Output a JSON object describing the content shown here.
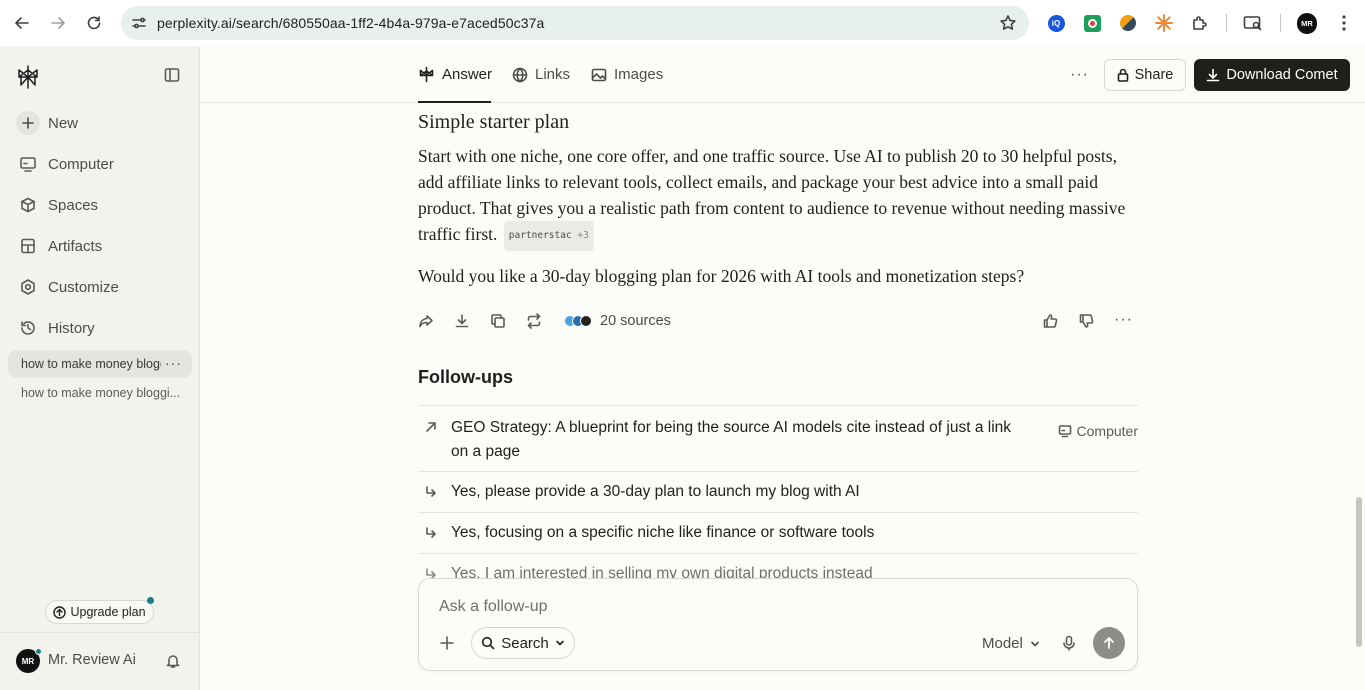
{
  "browser": {
    "url": "perplexity.ai/search/680550aa-1ff2-4b4a-979a-e7aced50c37a",
    "profile_initials": "MR"
  },
  "sidebar": {
    "items": [
      {
        "label": "New",
        "icon": "plus-icon"
      },
      {
        "label": "Computer",
        "icon": "computer-icon"
      },
      {
        "label": "Spaces",
        "icon": "spaces-icon"
      },
      {
        "label": "Artifacts",
        "icon": "artifacts-icon"
      },
      {
        "label": "Customize",
        "icon": "customize-icon"
      },
      {
        "label": "History",
        "icon": "history-icon"
      }
    ],
    "threads": [
      {
        "title": "how to make money blogging"
      },
      {
        "title": "how to make money bloggi..."
      }
    ],
    "upgrade_label": "Upgrade plan",
    "user": {
      "name": "Mr. Review Ai",
      "initials": "MR"
    }
  },
  "topbar": {
    "tabs": [
      {
        "label": "Answer",
        "active": true
      },
      {
        "label": "Links",
        "active": false
      },
      {
        "label": "Images",
        "active": false
      }
    ],
    "share_label": "Share",
    "download_label": "Download Comet"
  },
  "answer": {
    "heading": "Simple starter plan",
    "paragraph": "Start with one niche, one core offer, and one traffic source. Use AI to publish 20 to 30 helpful posts, add affiliate links to relevant tools, collect emails, and package your best advice into a small paid product. That gives you a realistic path from content to audience to revenue without needing massive traffic first.",
    "citation": {
      "label": "partnerstac",
      "more": "+3"
    },
    "question": "Would you like a 30-day blogging plan for 2026 with AI tools and monetization steps?",
    "sources_label": "20 sources"
  },
  "followups": {
    "title": "Follow-ups",
    "items": [
      {
        "text": "GEO Strategy: A blueprint for being the source AI models cite instead of just a link on a page",
        "tag": "Computer"
      },
      {
        "text": "Yes, please provide a 30-day plan to launch my blog with AI"
      },
      {
        "text": "Yes, focusing on a specific niche like finance or software tools"
      },
      {
        "text": "Yes, I am interested in selling my own digital products instead"
      }
    ]
  },
  "askbox": {
    "placeholder": "Ask a follow-up",
    "mode_label": "Search",
    "model_label": "Model"
  },
  "colors": {
    "accent": "#1f7a8c",
    "background": "#fcfcf9",
    "sidebar": "#f3f3ee",
    "primary_button": "#1f1f1c"
  }
}
